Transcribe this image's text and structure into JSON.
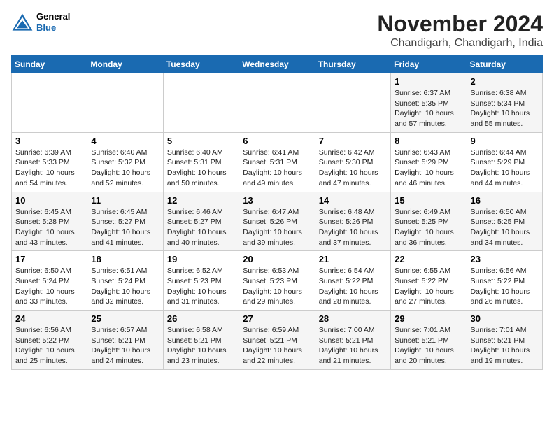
{
  "header": {
    "logo_line1": "General",
    "logo_line2": "Blue",
    "month_title": "November 2024",
    "location": "Chandigarh, Chandigarh, India"
  },
  "weekdays": [
    "Sunday",
    "Monday",
    "Tuesday",
    "Wednesday",
    "Thursday",
    "Friday",
    "Saturday"
  ],
  "weeks": [
    [
      {
        "day": "",
        "info": ""
      },
      {
        "day": "",
        "info": ""
      },
      {
        "day": "",
        "info": ""
      },
      {
        "day": "",
        "info": ""
      },
      {
        "day": "",
        "info": ""
      },
      {
        "day": "1",
        "info": "Sunrise: 6:37 AM\nSunset: 5:35 PM\nDaylight: 10 hours and 57 minutes."
      },
      {
        "day": "2",
        "info": "Sunrise: 6:38 AM\nSunset: 5:34 PM\nDaylight: 10 hours and 55 minutes."
      }
    ],
    [
      {
        "day": "3",
        "info": "Sunrise: 6:39 AM\nSunset: 5:33 PM\nDaylight: 10 hours and 54 minutes."
      },
      {
        "day": "4",
        "info": "Sunrise: 6:40 AM\nSunset: 5:32 PM\nDaylight: 10 hours and 52 minutes."
      },
      {
        "day": "5",
        "info": "Sunrise: 6:40 AM\nSunset: 5:31 PM\nDaylight: 10 hours and 50 minutes."
      },
      {
        "day": "6",
        "info": "Sunrise: 6:41 AM\nSunset: 5:31 PM\nDaylight: 10 hours and 49 minutes."
      },
      {
        "day": "7",
        "info": "Sunrise: 6:42 AM\nSunset: 5:30 PM\nDaylight: 10 hours and 47 minutes."
      },
      {
        "day": "8",
        "info": "Sunrise: 6:43 AM\nSunset: 5:29 PM\nDaylight: 10 hours and 46 minutes."
      },
      {
        "day": "9",
        "info": "Sunrise: 6:44 AM\nSunset: 5:29 PM\nDaylight: 10 hours and 44 minutes."
      }
    ],
    [
      {
        "day": "10",
        "info": "Sunrise: 6:45 AM\nSunset: 5:28 PM\nDaylight: 10 hours and 43 minutes."
      },
      {
        "day": "11",
        "info": "Sunrise: 6:45 AM\nSunset: 5:27 PM\nDaylight: 10 hours and 41 minutes."
      },
      {
        "day": "12",
        "info": "Sunrise: 6:46 AM\nSunset: 5:27 PM\nDaylight: 10 hours and 40 minutes."
      },
      {
        "day": "13",
        "info": "Sunrise: 6:47 AM\nSunset: 5:26 PM\nDaylight: 10 hours and 39 minutes."
      },
      {
        "day": "14",
        "info": "Sunrise: 6:48 AM\nSunset: 5:26 PM\nDaylight: 10 hours and 37 minutes."
      },
      {
        "day": "15",
        "info": "Sunrise: 6:49 AM\nSunset: 5:25 PM\nDaylight: 10 hours and 36 minutes."
      },
      {
        "day": "16",
        "info": "Sunrise: 6:50 AM\nSunset: 5:25 PM\nDaylight: 10 hours and 34 minutes."
      }
    ],
    [
      {
        "day": "17",
        "info": "Sunrise: 6:50 AM\nSunset: 5:24 PM\nDaylight: 10 hours and 33 minutes."
      },
      {
        "day": "18",
        "info": "Sunrise: 6:51 AM\nSunset: 5:24 PM\nDaylight: 10 hours and 32 minutes."
      },
      {
        "day": "19",
        "info": "Sunrise: 6:52 AM\nSunset: 5:23 PM\nDaylight: 10 hours and 31 minutes."
      },
      {
        "day": "20",
        "info": "Sunrise: 6:53 AM\nSunset: 5:23 PM\nDaylight: 10 hours and 29 minutes."
      },
      {
        "day": "21",
        "info": "Sunrise: 6:54 AM\nSunset: 5:22 PM\nDaylight: 10 hours and 28 minutes."
      },
      {
        "day": "22",
        "info": "Sunrise: 6:55 AM\nSunset: 5:22 PM\nDaylight: 10 hours and 27 minutes."
      },
      {
        "day": "23",
        "info": "Sunrise: 6:56 AM\nSunset: 5:22 PM\nDaylight: 10 hours and 26 minutes."
      }
    ],
    [
      {
        "day": "24",
        "info": "Sunrise: 6:56 AM\nSunset: 5:22 PM\nDaylight: 10 hours and 25 minutes."
      },
      {
        "day": "25",
        "info": "Sunrise: 6:57 AM\nSunset: 5:21 PM\nDaylight: 10 hours and 24 minutes."
      },
      {
        "day": "26",
        "info": "Sunrise: 6:58 AM\nSunset: 5:21 PM\nDaylight: 10 hours and 23 minutes."
      },
      {
        "day": "27",
        "info": "Sunrise: 6:59 AM\nSunset: 5:21 PM\nDaylight: 10 hours and 22 minutes."
      },
      {
        "day": "28",
        "info": "Sunrise: 7:00 AM\nSunset: 5:21 PM\nDaylight: 10 hours and 21 minutes."
      },
      {
        "day": "29",
        "info": "Sunrise: 7:01 AM\nSunset: 5:21 PM\nDaylight: 10 hours and 20 minutes."
      },
      {
        "day": "30",
        "info": "Sunrise: 7:01 AM\nSunset: 5:21 PM\nDaylight: 10 hours and 19 minutes."
      }
    ]
  ]
}
